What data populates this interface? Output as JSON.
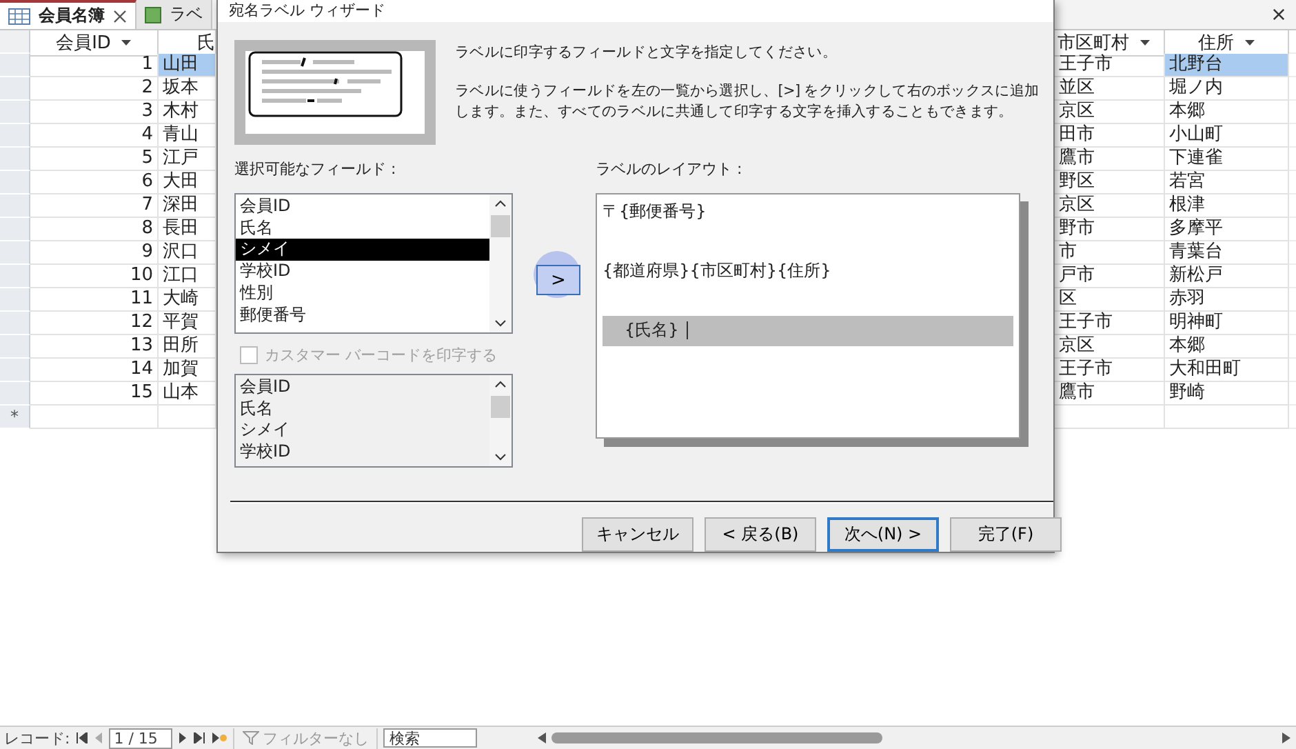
{
  "tabs": [
    {
      "label": "会員名簿",
      "selected": true
    },
    {
      "label": "ラベ",
      "selected": false
    }
  ],
  "datasheet": {
    "columns": [
      "会員ID",
      "氏",
      "市区町村",
      "住所"
    ],
    "rows": [
      {
        "id": "1",
        "name": "山田",
        "city": "王子市",
        "address": "北野台",
        "selected": true
      },
      {
        "id": "2",
        "name": "坂本",
        "city": "並区",
        "address": "堀ノ内",
        "selected": false
      },
      {
        "id": "3",
        "name": "木村",
        "city": "京区",
        "address": "本郷",
        "selected": false
      },
      {
        "id": "4",
        "name": "青山",
        "city": "田市",
        "address": "小山町",
        "selected": false
      },
      {
        "id": "5",
        "name": "江戸",
        "city": "鷹市",
        "address": "下連雀",
        "selected": false
      },
      {
        "id": "6",
        "name": "大田",
        "city": "野区",
        "address": "若宮",
        "selected": false
      },
      {
        "id": "7",
        "name": "深田",
        "city": "京区",
        "address": "根津",
        "selected": false
      },
      {
        "id": "8",
        "name": "長田",
        "city": "野市",
        "address": "多摩平",
        "selected": false
      },
      {
        "id": "9",
        "name": "沢口",
        "city": "市",
        "address": "青葉台",
        "selected": false
      },
      {
        "id": "10",
        "name": "江口",
        "city": "戸市",
        "address": "新松戸",
        "selected": false
      },
      {
        "id": "11",
        "name": "大崎",
        "city": "区",
        "address": "赤羽",
        "selected": false
      },
      {
        "id": "12",
        "name": "平賀",
        "city": "王子市",
        "address": "明神町",
        "selected": false
      },
      {
        "id": "13",
        "name": "田所",
        "city": "京区",
        "address": "本郷",
        "selected": false
      },
      {
        "id": "14",
        "name": "加賀",
        "city": "王子市",
        "address": "大和田町",
        "selected": false
      },
      {
        "id": "15",
        "name": "山本",
        "city": "鷹市",
        "address": "野崎",
        "selected": false
      }
    ],
    "new_row_marker": "*"
  },
  "dialog": {
    "title": "宛名ラベル ウィザード",
    "instruction": "ラベルに印字するフィールドと文字を指定してください。",
    "description": "ラベルに使うフィールドを左の一覧から選択し、[>] をクリックして右のボックスに追加します。また、すべてのラベルに共通して印字する文字を挿入することもできます。",
    "fields_label": "選択可能なフィールド :",
    "fields": [
      {
        "label": "会員ID",
        "selected": false
      },
      {
        "label": "氏名",
        "selected": false
      },
      {
        "label": "シメイ",
        "selected": true
      },
      {
        "label": "学校ID",
        "selected": false
      },
      {
        "label": "性別",
        "selected": false
      },
      {
        "label": "郵便番号",
        "selected": false
      }
    ],
    "add_button": ">",
    "barcode": {
      "label": "カスタマー バーコードを印字する",
      "checked": false,
      "disabled": true
    },
    "barcode_fields": [
      "会員ID",
      "氏名",
      "シメイ",
      "学校ID"
    ],
    "layout_label": "ラベルのレイアウト :",
    "layout_lines": [
      {
        "text": "〒{郵便番号}",
        "selected": false
      },
      {
        "selected": false
      },
      {
        "text": "{都道府県}{市区町村}{住所}",
        "selected": false
      },
      {
        "selected": false
      },
      {
        "text": "{氏名}",
        "selected": true
      }
    ],
    "buttons": [
      {
        "label": "キャンセル",
        "default": false
      },
      {
        "label": "< 戻る(B)",
        "default": false
      },
      {
        "label": "次へ(N) >",
        "default": true
      },
      {
        "label": "完了(F)",
        "default": false
      }
    ]
  },
  "navigator": {
    "label": "レコード:",
    "position": "1 / 15",
    "filter": "フィルターなし",
    "search_placeholder": "検索"
  }
}
